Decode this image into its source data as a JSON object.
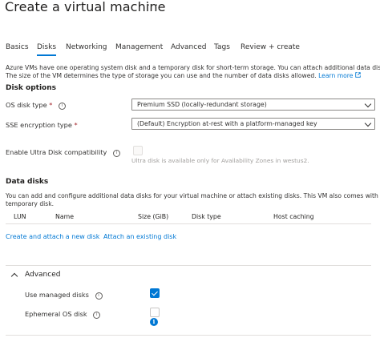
{
  "header": {
    "title": "Create a virtual machine",
    "more": "···"
  },
  "tabs": [
    {
      "label": "Basics"
    },
    {
      "label": "Disks"
    },
    {
      "label": "Networking"
    },
    {
      "label": "Management"
    },
    {
      "label": "Advanced"
    },
    {
      "label": "Tags"
    },
    {
      "label": "Review + create"
    }
  ],
  "intro": {
    "line1": "Azure VMs have one operating system disk and a temporary disk for short-term storage. You can attach additional data disks.",
    "line2": "The size of the VM determines the type of storage you can use and the number of data disks allowed.",
    "learn_more": "Learn more"
  },
  "disk_options": {
    "heading": "Disk options",
    "os_disk_type": {
      "label": "OS disk type",
      "required": "*",
      "value": "Premium SSD (locally-redundant storage)"
    },
    "sse": {
      "label": "SSE encryption type",
      "required": "*",
      "value": "(Default) Encryption at-rest with a platform-managed key"
    },
    "ultra": {
      "label": "Enable Ultra Disk compatibility",
      "note": "Ultra disk is available only for Availability Zones in westus2."
    }
  },
  "data_disks": {
    "heading": "Data disks",
    "desc1": "You can add and configure additional data disks for your virtual machine or attach existing disks. This VM also comes with a",
    "desc2": "temporary disk.",
    "columns": [
      "LUN",
      "Name",
      "Size (GiB)",
      "Disk type",
      "Host caching"
    ],
    "create_link": "Create and attach a new disk",
    "attach_link": "Attach an existing disk"
  },
  "advanced": {
    "heading": "Advanced",
    "managed": {
      "label": "Use managed disks",
      "checked": true
    },
    "ephemeral": {
      "label": "Ephemeral OS disk",
      "checked": false
    }
  },
  "colors": {
    "accent": "#0078d4",
    "required": "#a4262c"
  }
}
